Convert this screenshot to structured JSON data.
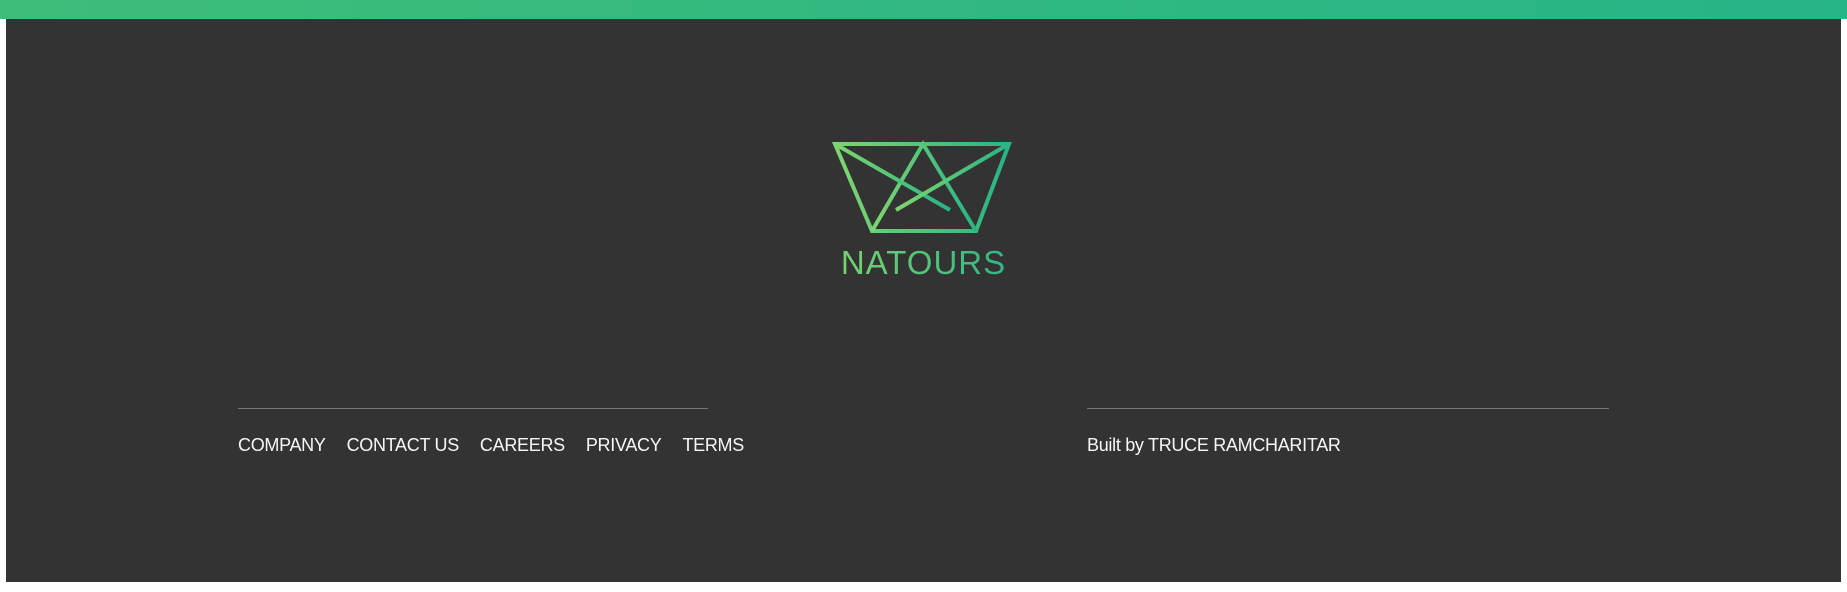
{
  "brand": {
    "name": "NATOURS",
    "logo_icon": "crown-logo-icon"
  },
  "footer": {
    "nav": [
      {
        "label": "COMPANY"
      },
      {
        "label": "CONTACT US"
      },
      {
        "label": "CAREERS"
      },
      {
        "label": "PRIVACY"
      },
      {
        "label": "TERMS"
      }
    ],
    "credit_prefix": "Built by",
    "credit_name": "TRUCE RAMCHARITAR"
  },
  "colors": {
    "top_band_start": "#3dbd79",
    "top_band_end": "#27b487",
    "footer_bg": "#333333",
    "logo_start": "#7ed56f",
    "logo_end": "#28b485",
    "text": "#f7f7f7",
    "divider": "#777777"
  }
}
